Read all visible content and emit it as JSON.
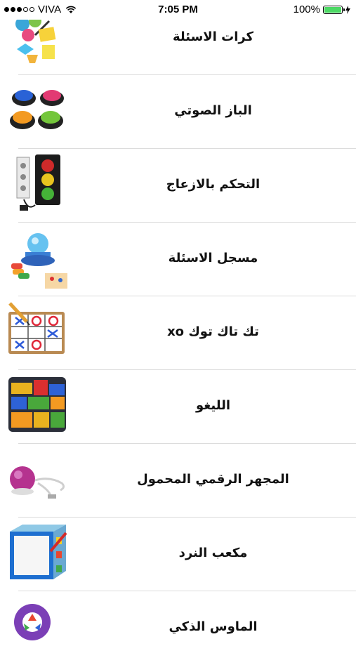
{
  "status_bar": {
    "carrier": "VIVA",
    "time": "7:05 PM",
    "battery": "100%",
    "battery_level": 1.0
  },
  "list": {
    "items": [
      {
        "title": "كرات الاسئلة",
        "icon": "question-balls-icon"
      },
      {
        "title": "الباز الصوتي",
        "icon": "buzzer-buttons-icon"
      },
      {
        "title": "التحكم بالازعاج",
        "icon": "traffic-light-icon"
      },
      {
        "title": "مسجل الاسئلة",
        "icon": "question-recorder-icon"
      },
      {
        "title": "تك تاك توك xo",
        "icon": "tic-tac-toe-icon"
      },
      {
        "title": "الليغو",
        "icon": "lego-bricks-icon"
      },
      {
        "title": "المجهر الرقمي المحمول",
        "icon": "digital-microscope-icon"
      },
      {
        "title": "مكعب النرد",
        "icon": "dice-cube-icon"
      },
      {
        "title": "الماوس الذكي",
        "icon": "smart-mouse-icon"
      }
    ]
  }
}
